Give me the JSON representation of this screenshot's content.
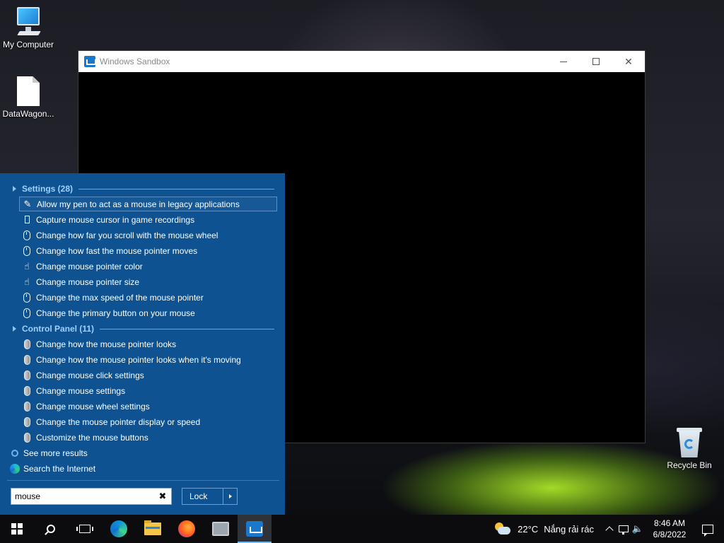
{
  "desktop": {
    "icons": [
      {
        "label": "My Computer",
        "icon": "computer-icon"
      },
      {
        "label": "DataWagon...",
        "icon": "file-icon"
      },
      {
        "label": "Recycle Bin",
        "icon": "recycle-bin-icon"
      }
    ]
  },
  "window": {
    "title": "Windows Sandbox",
    "icon": "windows-sandbox-icon"
  },
  "search_panel": {
    "categories": [
      {
        "label": "Settings (28)"
      },
      {
        "label": "Control Panel (11)"
      }
    ],
    "settings_items": [
      {
        "label": "Allow my pen to act as a mouse in legacy applications",
        "icon": "pen-icon",
        "selected": true
      },
      {
        "label": "Capture mouse cursor in game recordings",
        "icon": "rectangle-icon"
      },
      {
        "label": "Change how far you scroll with the mouse wheel",
        "icon": "mouse-icon"
      },
      {
        "label": "Change how fast the mouse pointer moves",
        "icon": "mouse-icon"
      },
      {
        "label": "Change mouse pointer color",
        "icon": "pointer-hand-icon"
      },
      {
        "label": "Change mouse pointer size",
        "icon": "pointer-hand-icon"
      },
      {
        "label": "Change the max speed of the mouse pointer",
        "icon": "mouse-icon"
      },
      {
        "label": "Change the primary button on your mouse",
        "icon": "mouse-icon"
      }
    ],
    "control_panel_items": [
      {
        "label": "Change how the mouse pointer looks",
        "icon": "mouse-control-panel-icon"
      },
      {
        "label": "Change how the mouse pointer looks when it's moving",
        "icon": "mouse-control-panel-icon"
      },
      {
        "label": "Change mouse click settings",
        "icon": "mouse-control-panel-icon"
      },
      {
        "label": "Change mouse settings",
        "icon": "mouse-control-panel-icon"
      },
      {
        "label": "Change mouse wheel settings",
        "icon": "mouse-control-panel-icon"
      },
      {
        "label": "Change the mouse pointer display or speed",
        "icon": "mouse-control-panel-icon"
      },
      {
        "label": "Customize the mouse buttons",
        "icon": "mouse-control-panel-icon"
      }
    ],
    "see_more": "See more results",
    "search_internet": "Search the Internet",
    "search_value": "mouse",
    "lock_label": "Lock"
  },
  "taskbar": {
    "apps": [
      {
        "name": "start",
        "icon": "windows-logo-icon"
      },
      {
        "name": "search",
        "icon": "search-icon"
      },
      {
        "name": "task-view",
        "icon": "task-view-icon"
      },
      {
        "name": "edge",
        "icon": "edge-icon"
      },
      {
        "name": "file-explorer",
        "icon": "folder-icon"
      },
      {
        "name": "firefox",
        "icon": "firefox-icon"
      },
      {
        "name": "monitor",
        "icon": "monitor-icon"
      },
      {
        "name": "windows-sandbox",
        "icon": "windows-sandbox-icon",
        "active": true
      }
    ],
    "weather": {
      "temp": "22°C",
      "condition": "Nắng rải rác"
    },
    "clock": {
      "time": "8:46 AM",
      "date": "6/8/2022"
    }
  },
  "colors": {
    "panel_bg": "#0e5292",
    "category_text": "#9fd0ff",
    "taskbar_bg": "#0c0c0e",
    "active_indicator": "#76b9ed"
  }
}
